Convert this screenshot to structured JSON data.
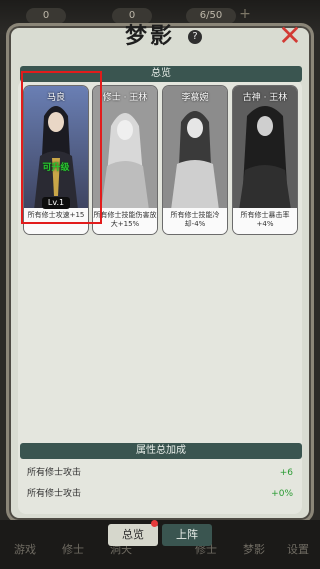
{
  "topbar": {
    "values": [
      "0",
      "0",
      "6/50"
    ]
  },
  "window": {
    "title": "梦影",
    "help": "?",
    "close": "✕"
  },
  "overview": {
    "header": "总览"
  },
  "cards": [
    {
      "name": "马良",
      "status": "可升级",
      "level": "Lv.1",
      "caption": "所有修士攻速+15",
      "selected": true
    },
    {
      "name": "修士 · 王林",
      "caption": "所有修士技能伤害放大+15%"
    },
    {
      "name": "李慕婉",
      "caption": "所有修士技能冷却-4%"
    },
    {
      "name": "古神 · 王林",
      "caption": "所有修士暴击率+4%"
    }
  ],
  "summary": {
    "header": "属性总加成",
    "rows": [
      {
        "label": "所有修士攻击",
        "value": "+6"
      },
      {
        "label": "所有修士攻击",
        "value": "+0%"
      }
    ]
  },
  "tabs": [
    {
      "label": "总览",
      "active": true
    },
    {
      "label": "上阵",
      "active": false
    }
  ],
  "bottom_labels": [
    "游戏",
    "修士",
    "洞天",
    "修士",
    "梦影",
    "设置"
  ],
  "colors": {
    "accent_green": "#3a5550",
    "highlight_red": "#e21c1c",
    "status_green": "#27c42f"
  }
}
